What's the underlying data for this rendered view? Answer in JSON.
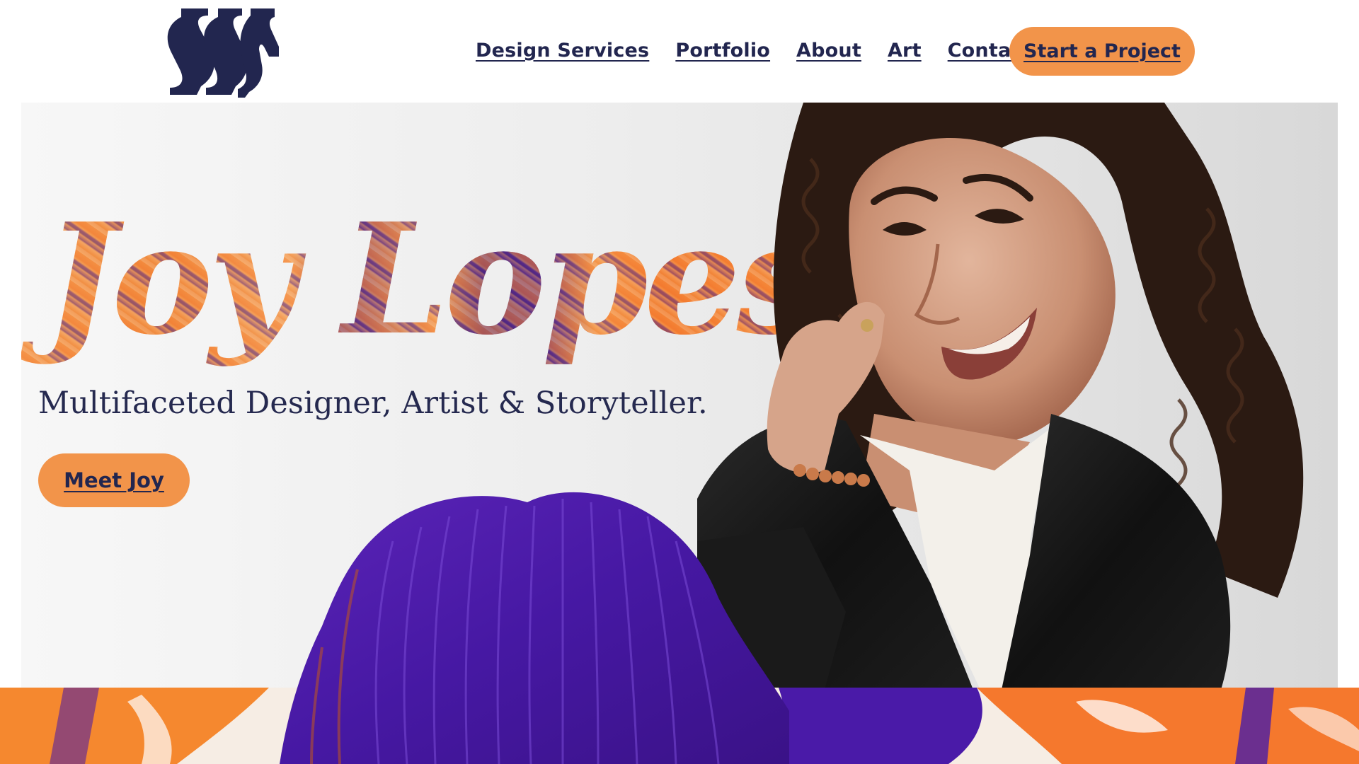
{
  "header": {
    "logo_name": "joy-logo",
    "nav": [
      {
        "label": "Design Services"
      },
      {
        "label": "Portfolio"
      },
      {
        "label": "About"
      },
      {
        "label": "Art"
      },
      {
        "label": "Contact"
      }
    ],
    "cta_label": "Start a Project"
  },
  "hero": {
    "title": "Joy Lopes",
    "subtitle": "Multifaceted Designer, Artist & Storyteller.",
    "button_label": "Meet Joy"
  },
  "colors": {
    "navy": "#22264f",
    "accent_orange": "#f2944a",
    "brush_purple": "#4a1aa8",
    "bright_orange": "#f5782d"
  }
}
